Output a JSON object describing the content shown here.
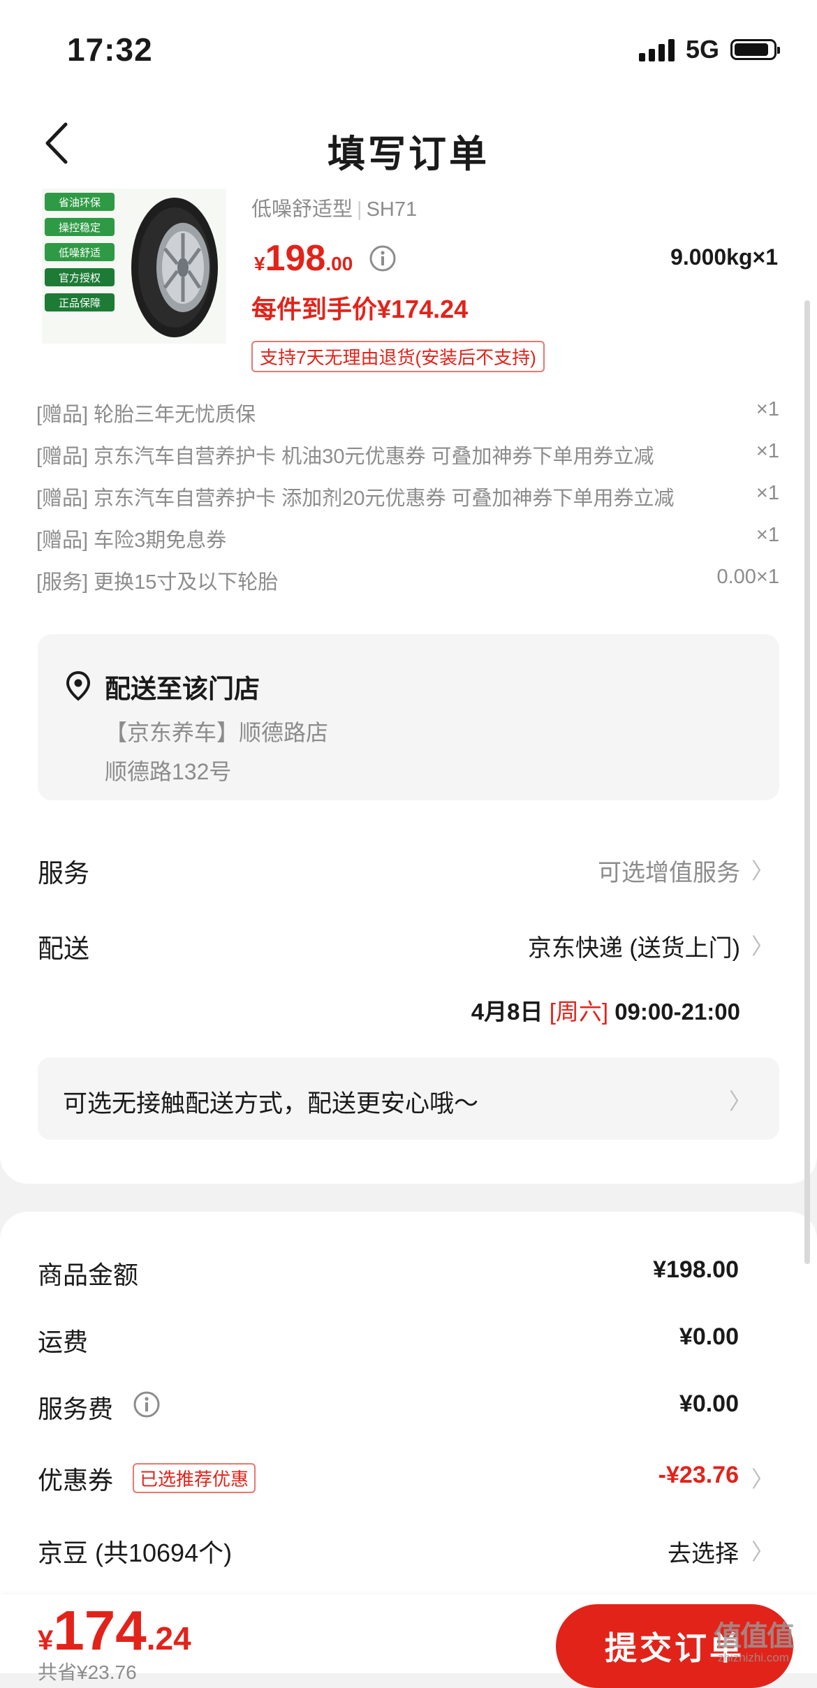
{
  "status_bar": {
    "time": "17:32",
    "network": "5G"
  },
  "header": {
    "title": "填写订单"
  },
  "product": {
    "badges": [
      "省油环保",
      "操控稳定",
      "低噪舒适",
      "官方授权",
      "正品保障"
    ],
    "spec_type": "低噪舒适型",
    "spec_model": "SH71",
    "price_yen": "¥",
    "price_int": "198",
    "price_dec": ".00",
    "weight_qty": "9.000kg×1",
    "final_price": "每件到手价¥174.24",
    "return_policy": "支持7天无理由退货(安装后不支持)"
  },
  "gifts": [
    {
      "text": "[赠品] 轮胎三年无忧质保",
      "qty": "×1"
    },
    {
      "text": "[赠品] 京东汽车自营养护卡 机油30元优惠券  可叠加神券下单用券立减",
      "qty": "×1"
    },
    {
      "text": "[赠品] 京东汽车自营养护卡 添加剂20元优惠券  可叠加神券下单用券立减",
      "qty": "×1"
    },
    {
      "text": "[赠品] 车险3期免息券",
      "qty": "×1"
    },
    {
      "text": "[服务] 更换15寸及以下轮胎",
      "qty": "0.00×1"
    }
  ],
  "address": {
    "title": "配送至该门店",
    "store": "【京东养车】顺德路店",
    "street": "顺德路132号"
  },
  "service": {
    "label": "服务",
    "value": "可选增值服务"
  },
  "delivery": {
    "label": "配送",
    "method": "京东快递 (送货上门)",
    "date": "4月8日",
    "weekday": "[周六]",
    "time": "09:00-21:00"
  },
  "notice": {
    "text": "可选无接触配送方式，配送更安心哦～"
  },
  "summary": {
    "goods_label": "商品金额",
    "goods_value": "¥198.00",
    "shipping_label": "运费",
    "shipping_value": "¥0.00",
    "service_fee_label": "服务费",
    "service_fee_value": "¥0.00",
    "coupon_label": "优惠券",
    "coupon_tag": "已选推荐优惠",
    "coupon_value": "-¥23.76",
    "jingdou_label": "京豆 (共10694个)",
    "jingdou_value": "去选择"
  },
  "bottom": {
    "total_yen": "¥",
    "total_int": "174",
    "total_dec": ".24",
    "saved": "共省¥23.76",
    "submit": "提交订单"
  },
  "watermark": {
    "logo": "值值值",
    "site": "zhizhizhi.com"
  },
  "colors": {
    "accent_red": "#e2231a",
    "badge_green": "#2f9a45",
    "muted_gray": "#8c8c8c"
  }
}
